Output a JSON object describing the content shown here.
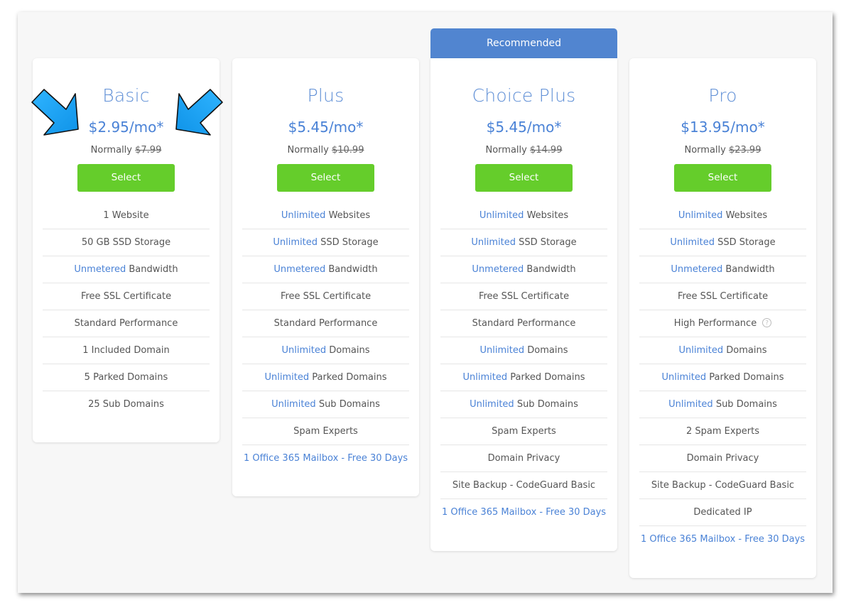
{
  "recommended_label": "Recommended",
  "colors": {
    "accent_blue": "#4a82d6",
    "recommended_bg": "#5185d0",
    "select_green": "#65cd2b",
    "arrow_blue": "#1aa3f5"
  },
  "annotations": {
    "left_arrow": "arrow-pointing-down-right",
    "right_arrow": "arrow-pointing-down-left"
  },
  "plans": [
    {
      "name": "Basic",
      "price": "$2.95/mo*",
      "normally_label": "Normally",
      "normal_price": "$7.99",
      "select_label": "Select",
      "features": [
        {
          "highlight": "",
          "text": "1 Website"
        },
        {
          "highlight": "",
          "text": "50 GB SSD Storage"
        },
        {
          "highlight": "Unmetered",
          "text": " Bandwidth"
        },
        {
          "highlight": "",
          "text": "Free SSL Certificate"
        },
        {
          "highlight": "",
          "text": "Standard Performance"
        },
        {
          "highlight": "",
          "text": "1 Included Domain"
        },
        {
          "highlight": "",
          "text": "5 Parked Domains"
        },
        {
          "highlight": "",
          "text": "25 Sub Domains"
        }
      ]
    },
    {
      "name": "Plus",
      "price": "$5.45/mo*",
      "normally_label": "Normally",
      "normal_price": "$10.99",
      "select_label": "Select",
      "features": [
        {
          "highlight": "Unlimited",
          "text": " Websites"
        },
        {
          "highlight": "Unlimited",
          "text": " SSD Storage"
        },
        {
          "highlight": "Unmetered",
          "text": " Bandwidth"
        },
        {
          "highlight": "",
          "text": "Free SSL Certificate"
        },
        {
          "highlight": "",
          "text": "Standard Performance"
        },
        {
          "highlight": "Unlimited",
          "text": " Domains"
        },
        {
          "highlight": "Unlimited",
          "text": " Parked Domains"
        },
        {
          "highlight": "Unlimited",
          "text": " Sub Domains"
        },
        {
          "highlight": "",
          "text": "Spam Experts"
        },
        {
          "highlight": "",
          "text": "1 Office 365 Mailbox - Free 30 Days",
          "link": true
        }
      ]
    },
    {
      "name": "Choice Plus",
      "price": "$5.45/mo*",
      "normally_label": "Normally",
      "normal_price": "$14.99",
      "select_label": "Select",
      "features": [
        {
          "highlight": "Unlimited",
          "text": " Websites"
        },
        {
          "highlight": "Unlimited",
          "text": " SSD Storage"
        },
        {
          "highlight": "Unmetered",
          "text": " Bandwidth"
        },
        {
          "highlight": "",
          "text": "Free SSL Certificate"
        },
        {
          "highlight": "",
          "text": "Standard Performance"
        },
        {
          "highlight": "Unlimited",
          "text": " Domains"
        },
        {
          "highlight": "Unlimited",
          "text": " Parked Domains"
        },
        {
          "highlight": "Unlimited",
          "text": " Sub Domains"
        },
        {
          "highlight": "",
          "text": "Spam Experts"
        },
        {
          "highlight": "",
          "text": "Domain Privacy"
        },
        {
          "highlight": "",
          "text": "Site Backup - CodeGuard Basic"
        },
        {
          "highlight": "",
          "text": "1 Office 365 Mailbox - Free 30 Days",
          "link": true
        }
      ]
    },
    {
      "name": "Pro",
      "price": "$13.95/mo*",
      "normally_label": "Normally",
      "normal_price": "$23.99",
      "select_label": "Select",
      "features": [
        {
          "highlight": "Unlimited",
          "text": " Websites"
        },
        {
          "highlight": "Unlimited",
          "text": " SSD Storage"
        },
        {
          "highlight": "Unmetered",
          "text": " Bandwidth"
        },
        {
          "highlight": "",
          "text": "Free SSL Certificate"
        },
        {
          "highlight": "",
          "text": "High Performance",
          "help_icon": "?"
        },
        {
          "highlight": "Unlimited",
          "text": " Domains"
        },
        {
          "highlight": "Unlimited",
          "text": " Parked Domains"
        },
        {
          "highlight": "Unlimited",
          "text": " Sub Domains"
        },
        {
          "highlight": "",
          "text": "2 Spam Experts"
        },
        {
          "highlight": "",
          "text": "Domain Privacy"
        },
        {
          "highlight": "",
          "text": "Site Backup - CodeGuard Basic"
        },
        {
          "highlight": "",
          "text": "Dedicated IP"
        },
        {
          "highlight": "",
          "text": "1 Office 365 Mailbox - Free 30 Days",
          "link": true
        }
      ]
    }
  ]
}
